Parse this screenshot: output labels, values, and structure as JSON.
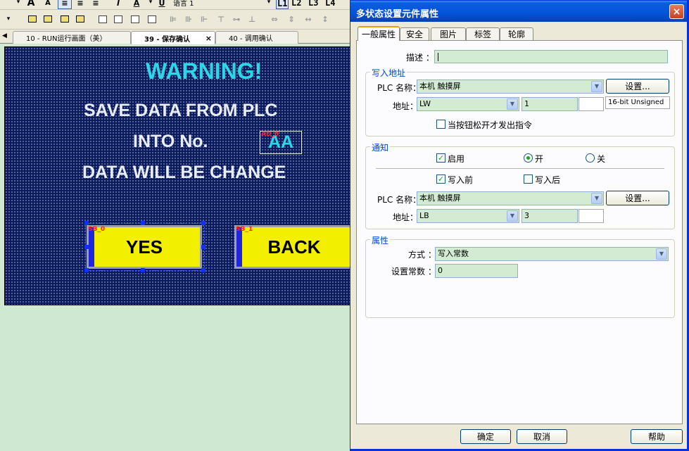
{
  "toolbar": {
    "text_a_big": "A",
    "text_a_small": "A",
    "font_color_letter": "A",
    "underline_letter": "U",
    "lang_label": "语言 1",
    "levels": [
      "L1",
      "L2",
      "L3",
      "L4"
    ]
  },
  "tabs": [
    {
      "label": "10 - RUN运行画面（美）"
    },
    {
      "label": "39 - 保存确认",
      "active": true
    },
    {
      "label": "40 - 调用确认"
    }
  ],
  "canvas": {
    "warning": "WARNING!",
    "line1": "SAVE DATA FROM PLC",
    "line2": "INTO No.",
    "line3": "DATA WILL BE CHANGE",
    "aa_tag": "AD_0",
    "aa_value": "AA",
    "yes_tag": "SB_0",
    "yes_label": "YES",
    "back_tag": "SB_1",
    "back_label": "BACK"
  },
  "dialog": {
    "title": "多状态设置元件属性",
    "close": "×",
    "tabs": [
      "一般属性",
      "安全",
      "图片",
      "标签",
      "轮廓"
    ],
    "description_label": "描述 ：",
    "description_value": "",
    "write_address": {
      "title": "写入地址",
      "plc_label": "PLC 名称：",
      "plc_value": "本机 触摸屏",
      "settings_button": "设置...",
      "address_label": "地址：",
      "address_type": "LW",
      "address_value": "1",
      "data_format": "16-bit Unsigned",
      "release_checkbox": "当按钮松开才发出指令"
    },
    "notify": {
      "title": "通知",
      "enable": "启用",
      "on": "开",
      "off": "关",
      "before_write": "写入前",
      "after_write": "写入后",
      "plc_label": "PLC 名称：",
      "plc_value": "本机 触摸屏",
      "settings_button": "设置...",
      "address_label": "地址：",
      "address_type": "LB",
      "address_value": "3"
    },
    "attributes": {
      "title": "属性",
      "mode_label": "方式 ：",
      "mode_value": "写入常数",
      "constant_label": "设置常数 ：",
      "constant_value": "0"
    },
    "ok": "确定",
    "cancel": "取消",
    "help": "帮助"
  },
  "colors": {
    "canvas_bg": "#0b1a5c",
    "warning_cyan": "#2ad8e8",
    "button_yellow": "#f2ef00",
    "button_blue": "#2026e0",
    "titlebar_blue": "#0453d8",
    "field_green": "#d2ebd2"
  }
}
